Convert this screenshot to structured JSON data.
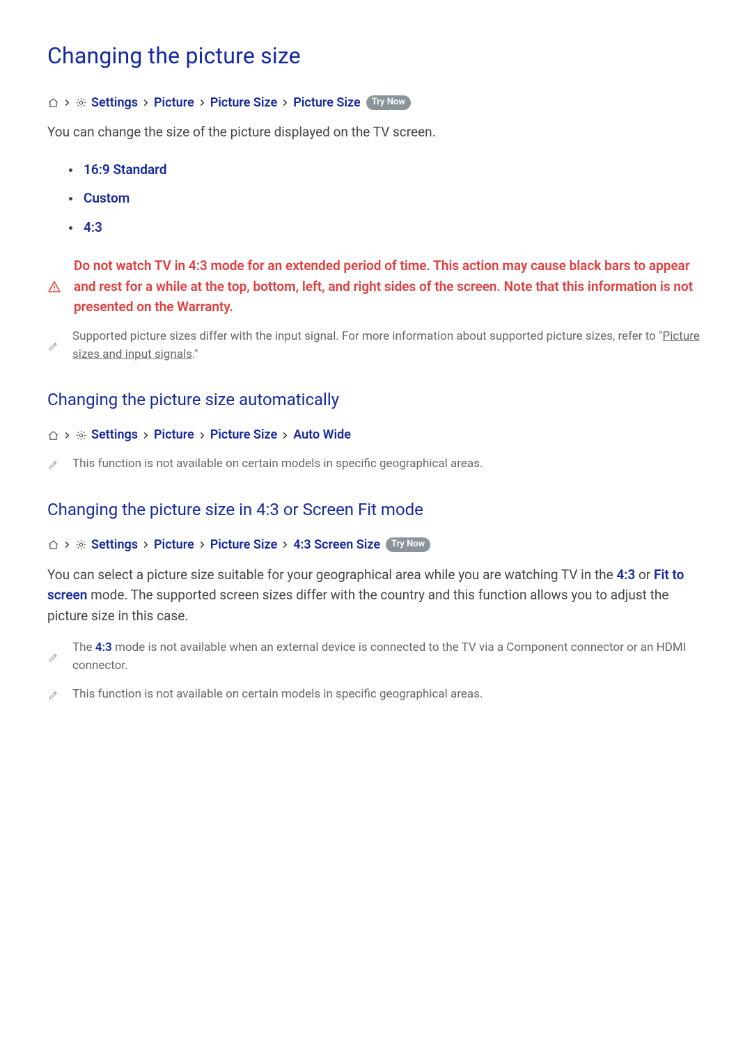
{
  "h1": "Changing the picture size",
  "bc1": {
    "settings": "Settings",
    "picture": "Picture",
    "psize1": "Picture Size",
    "psize2": "Picture Size",
    "try": "Try Now"
  },
  "para1": "You can change the size of the picture displayed on the TV screen.",
  "opts": {
    "a": "16:9 Standard",
    "b": "Custom",
    "c": "4:3"
  },
  "warn1": "Do not watch TV in 4:3 mode for an extended period of time. This action may cause black bars to appear and rest for a while at the top, bottom, left, and right sides of the screen. Note that this information is not presented on the Warranty.",
  "note1a": "Supported picture sizes differ with the input signal. For more information about supported picture sizes, refer to \"",
  "note1link": "Picture sizes and input signals",
  "note1b": ".\"",
  "h2a": "Changing the picture size automatically",
  "bc2": {
    "settings": "Settings",
    "picture": "Picture",
    "psize": "Picture Size",
    "autowide": "Auto Wide"
  },
  "note2": "This function is not available on certain models in specific geographical areas.",
  "h2b": "Changing the picture size in 4:3 or Screen Fit mode",
  "bc3": {
    "settings": "Settings",
    "picture": "Picture",
    "psize": "Picture Size",
    "s43": "4:3 Screen Size",
    "try": "Try Now"
  },
  "para2a": "You can select a picture size suitable for your geographical area while you are watching TV in the ",
  "para2_43": "4:3",
  "para2b": " or ",
  "para2_fit": "Fit to screen",
  "para2c": " mode. The supported screen sizes differ with the country and this function allows you to adjust the picture size in this case.",
  "note3a": "The ",
  "note3_43": "4:3",
  "note3b": " mode is not available when an external device is connected to the TV via a Component connector or an HDMI connector.",
  "note4": "This function is not available on certain models in specific geographical areas."
}
